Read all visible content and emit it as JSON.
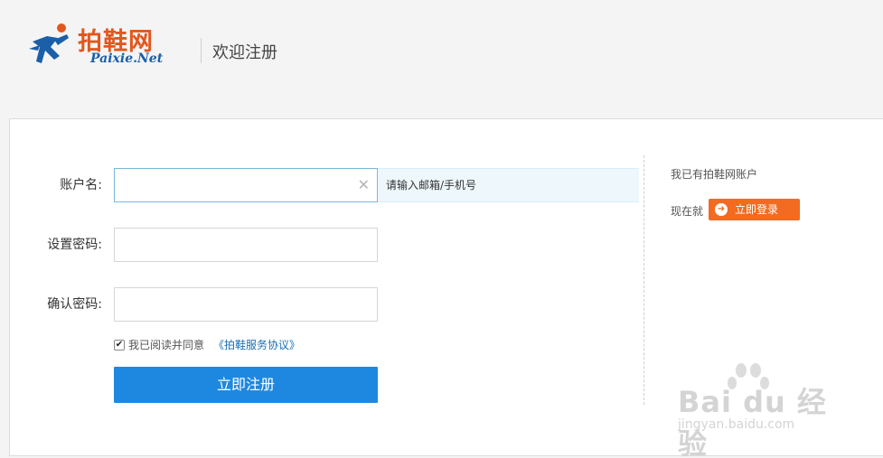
{
  "header": {
    "logo_cn": "拍鞋网",
    "logo_en": "Paixie.Net",
    "title": "欢迎注册"
  },
  "form": {
    "account_label": "账户名:",
    "account_value": "",
    "account_hint": "请输入邮箱/手机号",
    "password_label": "设置密码:",
    "password_value": "",
    "confirm_label": "确认密码:",
    "confirm_value": "",
    "agree_text": "我已阅读并同意",
    "agree_link": "《拍鞋服务协议》",
    "agree_checked": true,
    "register_button": "立即注册"
  },
  "side": {
    "have_account": "我已有拍鞋网账户",
    "now_text": "现在就",
    "login_button": "立即登录"
  },
  "watermark": {
    "main": "Bai du 经验",
    "url": "jingyan.baidu.com"
  },
  "colors": {
    "brand_orange": "#e2571e",
    "brand_blue": "#1a5fa8",
    "register_button": "#1e88e0",
    "login_button": "#f26b21",
    "hint_background": "#eef7fc"
  }
}
